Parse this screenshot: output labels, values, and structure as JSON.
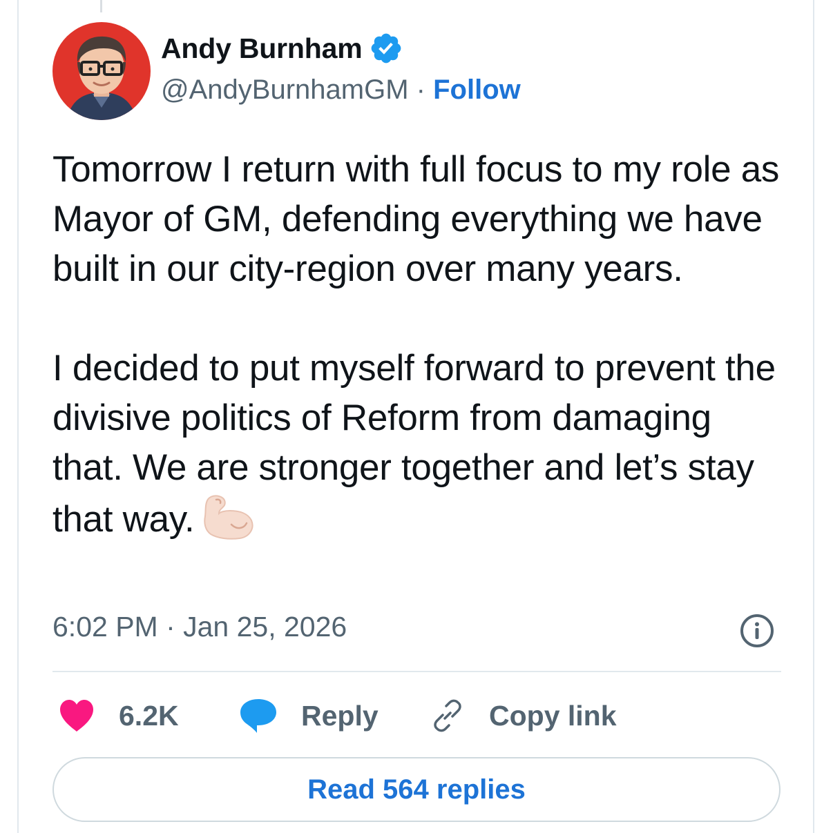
{
  "author": {
    "display_name": "Andy Burnham",
    "handle": "@AndyBurnhamGM",
    "separator": "·",
    "follow_label": "Follow",
    "verified": true
  },
  "tweet": {
    "paragraph_1": "Tomorrow I return with full focus to my role as Mayor of GM, defending everything we have built in our city-region over many years.",
    "paragraph_2": "I decided to put myself forward to prevent the divisive politics of Reform from damaging that. We are stronger together and let’s stay that way.",
    "emoji": "flexed-biceps",
    "timestamp": "6:02 PM · Jan 25, 2026"
  },
  "actions": {
    "like_count": "6.2K",
    "reply_label": "Reply",
    "copy_link_label": "Copy link"
  },
  "read_replies_label": "Read 564 replies",
  "icons": {
    "like": "heart-icon",
    "reply": "speech-bubble-icon",
    "copy_link": "link-icon",
    "info": "info-icon",
    "verified": "verified-badge-icon"
  },
  "colors": {
    "accent": "#1d73d6",
    "heart": "#f91880",
    "reply_bubble": "#1d9bf0",
    "muted_text": "#536471",
    "avatar_bg": "#e0342b"
  }
}
